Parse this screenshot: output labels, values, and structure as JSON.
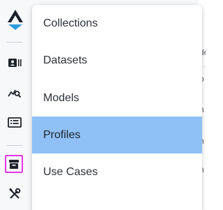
{
  "menu": {
    "items": [
      {
        "label": "Collections",
        "selected": false
      },
      {
        "label": "Datasets",
        "selected": false
      },
      {
        "label": "Models",
        "selected": false
      },
      {
        "label": "Profiles",
        "selected": true
      },
      {
        "label": "Use Cases",
        "selected": false
      }
    ]
  },
  "rail": {
    "icons": [
      "logo-icon",
      "contact-card-icon",
      "chart-search-icon",
      "list-panel-icon",
      "archive-box-icon",
      "tools-icon"
    ],
    "active": "archive-box-icon",
    "active_color": "#e637e6"
  },
  "background": {
    "chars": [
      "de",
      "o",
      "n",
      "n",
      "n"
    ]
  },
  "colors": {
    "selected_bg": "#8fc1f7",
    "logo_dark": "#1b1f2a",
    "logo_blue": "#2d9cdb"
  }
}
